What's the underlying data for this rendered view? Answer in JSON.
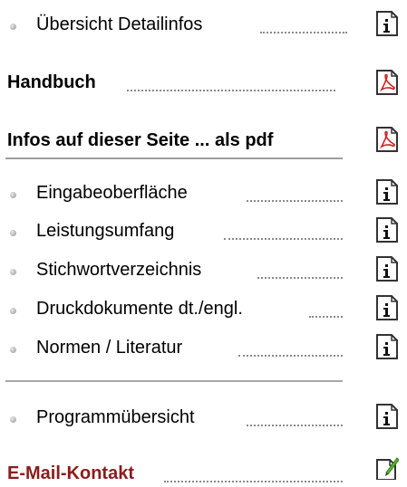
{
  "overview": {
    "label": "Übersicht Detailinfos",
    "icon": "info-document-icon"
  },
  "manual": {
    "label": "Handbuch",
    "icon": "pdf-document-icon"
  },
  "pdf_section": {
    "label": "Infos auf dieser Seite ... als pdf",
    "icon": "pdf-document-icon",
    "items": [
      {
        "label": "Eingabeoberfläche",
        "icon": "info-document-icon"
      },
      {
        "label": "Leistungsumfang",
        "icon": "info-document-icon"
      },
      {
        "label": "Stichwortverzeichnis",
        "icon": "info-document-icon"
      },
      {
        "label": "Druckdokumente dt./engl.",
        "icon": "info-document-icon"
      },
      {
        "label": "Normen / Literatur",
        "icon": "info-document-icon"
      }
    ]
  },
  "program": {
    "label": "Programmübersicht",
    "icon": "info-document-icon"
  },
  "contact": {
    "label": "E-Mail-Kontakt",
    "icon": "edit-document-icon",
    "color": "#8b1c1c"
  },
  "colors": {
    "dots": "#8a8a8a",
    "separator": "#9e9e9e",
    "icon_border": "#333333",
    "pdf_red": "#d32020",
    "pencil_green": "#5cb82e"
  }
}
